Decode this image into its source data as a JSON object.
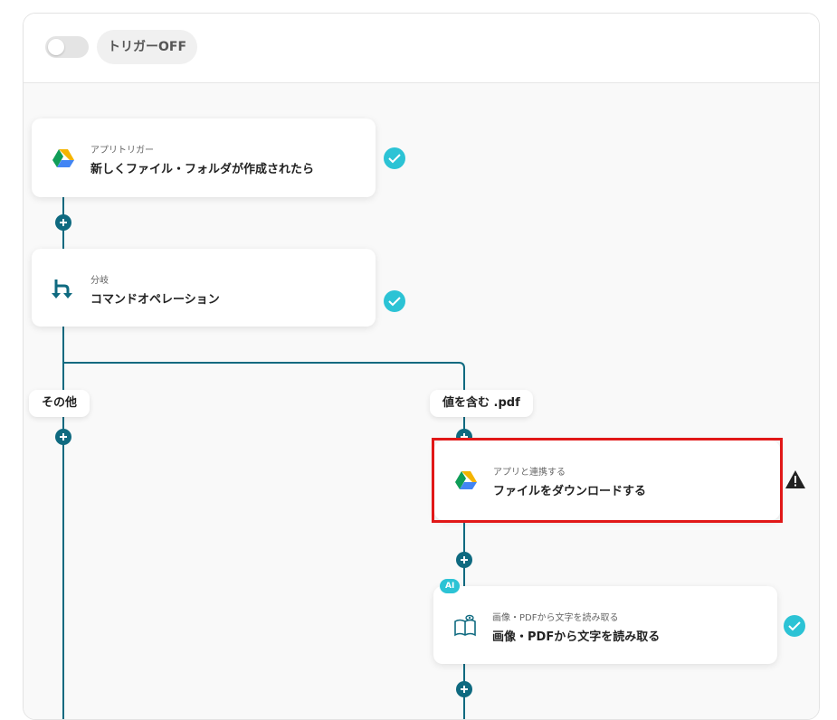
{
  "header": {
    "trigger_toggle_state": "off",
    "trigger_label": "トリガーOFF"
  },
  "steps": [
    {
      "type_label": "アプリトリガー",
      "title": "新しくファイル・フォルダが作成されたら",
      "icon": "google-drive-icon",
      "status": "done"
    },
    {
      "type_label": "分岐",
      "title": "コマンドオペレーション",
      "icon": "branch-icon",
      "status": "done"
    },
    {
      "type_label": "アプリと連携する",
      "title": "ファイルをダウンロードする",
      "icon": "google-drive-icon",
      "status": "warning"
    },
    {
      "badge": "AI",
      "type_label": "画像・PDFから文字を読み取る",
      "title": "画像・PDFから文字を読み取る",
      "icon": "book-eye-icon",
      "status": "done"
    }
  ],
  "branches": [
    {
      "label": "その他"
    },
    {
      "label": "値を含む .pdf"
    }
  ],
  "colors": {
    "connector": "#0f6a80",
    "check": "#2cc3d5",
    "highlight": "#e11818",
    "drive_green": "#0f9d58",
    "drive_yellow": "#f4b400",
    "drive_blue": "#4285f4"
  }
}
